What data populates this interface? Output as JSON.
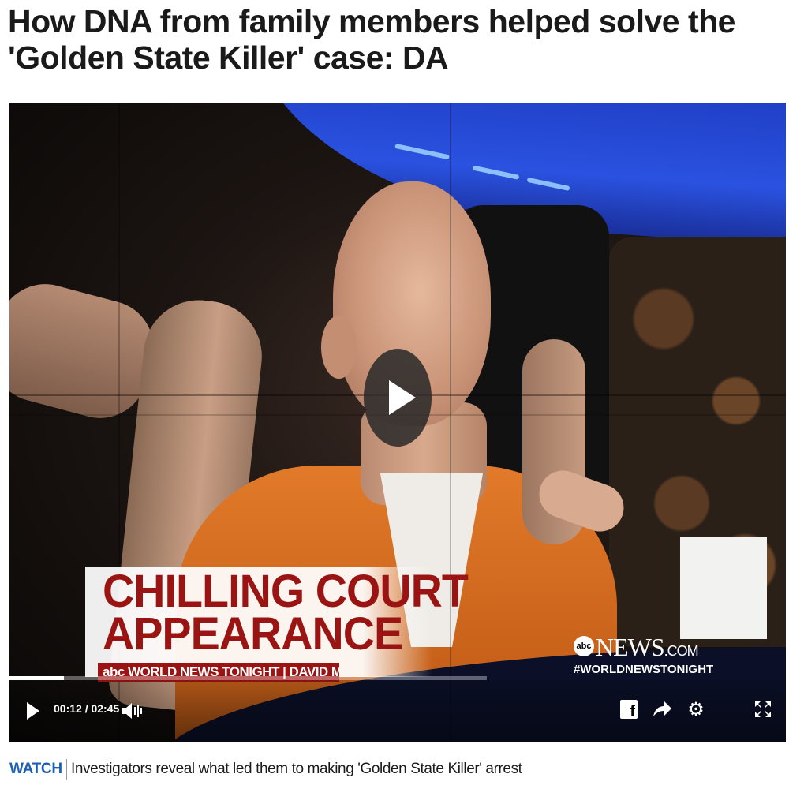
{
  "article": {
    "headline": "How DNA from family members helped solve the 'Golden State Killer' case: DA"
  },
  "video": {
    "lower_third_line1": "CHILLING COURT",
    "lower_third_line2": "APPEARANCE",
    "lower_third_strip": "abc WORLD NEWS TONIGHT | DAVID MUIR",
    "network_bug": {
      "logo": "abc",
      "name": "NEWS",
      "suffix": ".COM",
      "hashtag": "#WORLDNEWSTONIGHT"
    },
    "current_time": "00:12",
    "duration": "02:45",
    "time_display": "00:12 / 02:45",
    "progress_fraction": 0.07,
    "buffered_fraction": 0.615,
    "controls": {
      "play_icon": "play-icon",
      "volume_icon": "volume-icon",
      "facebook_icon": "facebook-icon",
      "share_icon": "share-arrow-icon",
      "settings_icon": "gear-icon",
      "fullscreen_icon": "fullscreen-icon"
    }
  },
  "caption": {
    "watch_label": "WATCH",
    "text": "Investigators reveal what led them to making 'Golden State Killer' arrest"
  },
  "colors": {
    "watch_blue": "#1c5fb3",
    "lower_third_red": "#9a1414"
  }
}
